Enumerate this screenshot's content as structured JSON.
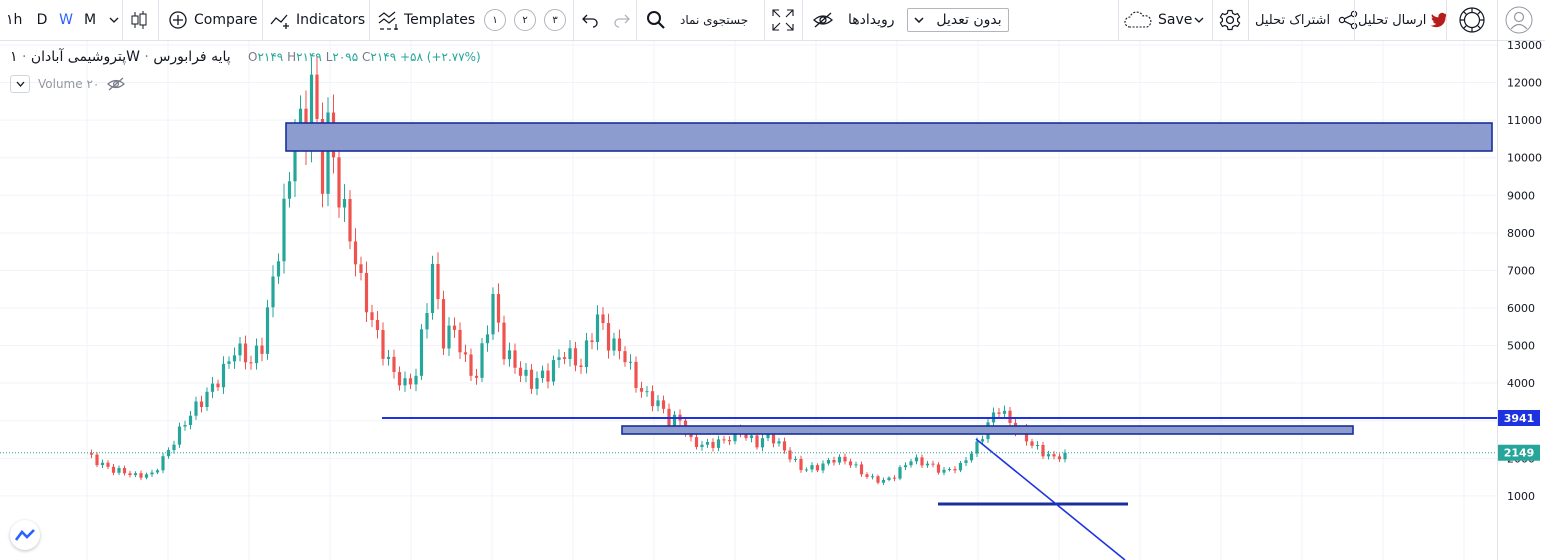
{
  "toolbar": {
    "intervals": [
      "۱h",
      "D",
      "W",
      "M"
    ],
    "active_interval": "W",
    "compare_label": "Compare",
    "indicators_label": "Indicators",
    "templates_label": "Templates",
    "layout_numbers": [
      "۱",
      "۲",
      "۳"
    ],
    "symbol_search_label": "جستجوی نماد",
    "events_label": "رویدادها",
    "adjustment_value": "بدون تعدیل",
    "save_label": "Save",
    "share_label": "اشتراک تحلیل",
    "tweet_label": "ارسال تحلیل"
  },
  "legend": {
    "symbol": "پتروشیمی آبادان",
    "interval": "۱W",
    "market": "پایه فرابورس",
    "open_key": "O",
    "open": "۲۱۴۹",
    "high_key": "H",
    "high": "۲۱۴۹",
    "low_key": "L",
    "low": "۲۰۹۵",
    "close_key": "C",
    "close": "۲۱۴۹",
    "change": "+۵۸ (+۲.۷۷%)",
    "volume_label": "Volume ۲۰"
  },
  "colors": {
    "up": "#26a69a",
    "down": "#ef5350",
    "zone_fill": "#8c9ccf",
    "zone_stroke": "#1a2f9e",
    "line": "#1e33e0",
    "accent": "#2962ff",
    "price_badge": "#26a69a"
  },
  "chart_data": {
    "type": "candlestick",
    "timeframe": "1W",
    "ylim": [
      200,
      13600
    ],
    "y_ticks": [
      1000,
      2000,
      3000,
      4000,
      5000,
      6000,
      7000,
      8000,
      9000,
      10000,
      11000,
      12000,
      13000
    ],
    "y_tick_labels": [
      "1000",
      "2000",
      "3000",
      "4000",
      "5000",
      "6000",
      "7000",
      "8000",
      "9000",
      "10000",
      "11000",
      "12000",
      "13000"
    ],
    "last_price": 2149,
    "last_price_label": "2149",
    "level_price": 3941,
    "level_label": "3941",
    "waypoints": [
      [
        1,
        2050
      ],
      [
        5,
        1700
      ],
      [
        9,
        1500
      ],
      [
        12,
        1600
      ],
      [
        15,
        2250
      ],
      [
        18,
        2900
      ],
      [
        21,
        3500
      ],
      [
        24,
        4200
      ],
      [
        27,
        4900
      ],
      [
        30,
        4450
      ],
      [
        32,
        5000
      ],
      [
        35,
        7800
      ],
      [
        37,
        9600
      ],
      [
        38,
        10800
      ],
      [
        40,
        10400
      ],
      [
        41,
        11900
      ],
      [
        42,
        10500
      ],
      [
        43,
        9500
      ],
      [
        44,
        11000
      ],
      [
        46,
        9300
      ],
      [
        48,
        8000
      ],
      [
        50,
        6500
      ],
      [
        52,
        5500
      ],
      [
        55,
        4600
      ],
      [
        58,
        4000
      ],
      [
        60,
        4200
      ],
      [
        63,
        6900
      ],
      [
        65,
        5200
      ],
      [
        67,
        5600
      ],
      [
        69,
        4600
      ],
      [
        71,
        4100
      ],
      [
        74,
        6100
      ],
      [
        76,
        4900
      ],
      [
        78,
        4600
      ],
      [
        81,
        4000
      ],
      [
        84,
        4150
      ],
      [
        87,
        4900
      ],
      [
        90,
        4600
      ],
      [
        93,
        5650
      ],
      [
        95,
        5000
      ],
      [
        98,
        4800
      ],
      [
        100,
        4100
      ],
      [
        102,
        3650
      ],
      [
        104,
        3400
      ],
      [
        106,
        2950
      ],
      [
        108,
        3050
      ],
      [
        110,
        2500
      ],
      [
        113,
        2350
      ],
      [
        116,
        2400
      ],
      [
        119,
        2750
      ],
      [
        122,
        2450
      ],
      [
        124,
        2650
      ],
      [
        127,
        2150
      ],
      [
        130,
        1750
      ],
      [
        133,
        1800
      ],
      [
        136,
        1950
      ],
      [
        139,
        1850
      ],
      [
        142,
        1550
      ],
      [
        145,
        1400
      ],
      [
        147,
        1500
      ],
      [
        150,
        1950
      ],
      [
        153,
        1900
      ],
      [
        156,
        1650
      ],
      [
        159,
        1750
      ],
      [
        162,
        2350
      ],
      [
        164,
        3000
      ],
      [
        166,
        3400
      ],
      [
        168,
        2900
      ],
      [
        170,
        2600
      ],
      [
        172,
        2350
      ],
      [
        174,
        2200
      ],
      [
        176,
        2050
      ],
      [
        177,
        2100
      ],
      [
        178,
        2149
      ]
    ]
  }
}
